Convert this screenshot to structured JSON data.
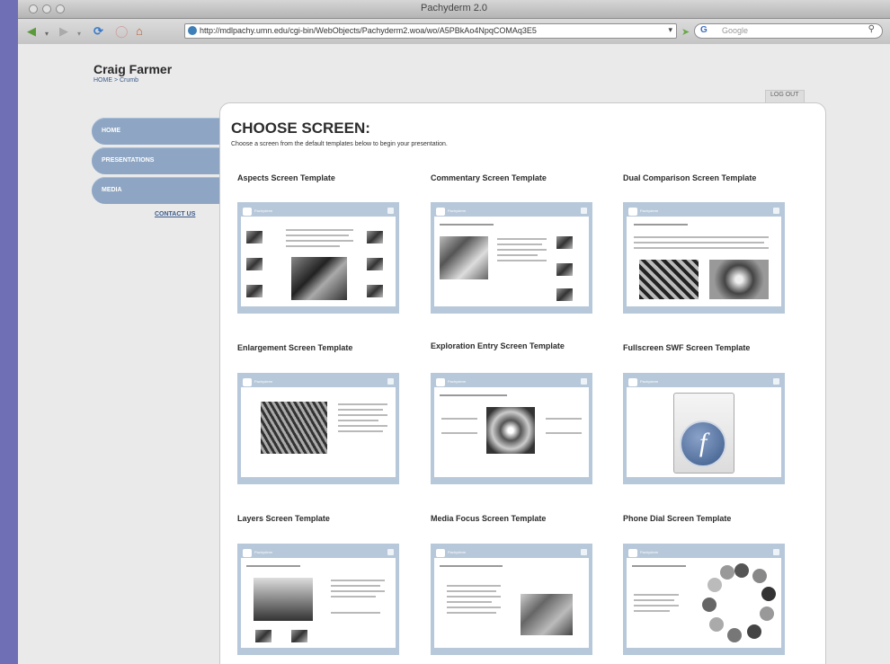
{
  "browser": {
    "window_title": "Pachyderm 2.0",
    "url": "http://mdlpachy.umn.edu/cgi-bin/WebObjects/Pachyderm2.woa/wo/A5PBkAo4NpqCOMAq3E5",
    "search_placeholder": "Google",
    "search_engine_label": "G"
  },
  "header": {
    "user_name": "Craig Farmer",
    "breadcrumb": "HOME > Crumb",
    "logout_label": "LOG OUT"
  },
  "nav": {
    "items": [
      {
        "label": "HOME"
      },
      {
        "label": "PRESENTATIONS"
      },
      {
        "label": "MEDIA"
      }
    ],
    "contact_label": "CONTACT US"
  },
  "main": {
    "heading": "CHOOSE SCREEN:",
    "subtitle": "Choose a screen from the default templates below to begin your presentation.",
    "thumb_header_label": "Pachyderm",
    "templates": [
      {
        "name": "Aspects Screen Template"
      },
      {
        "name": "Commentary Screen Template"
      },
      {
        "name": "Dual Comparison Screen Template"
      },
      {
        "name": "Enlargement Screen Template"
      },
      {
        "name": "Exploration Entry Screen Template"
      },
      {
        "name": "Fullscreen SWF Screen Template"
      },
      {
        "name": "Layers Screen Template"
      },
      {
        "name": "Media Focus Screen Template"
      },
      {
        "name": "Phone Dial Screen Template"
      }
    ]
  },
  "colors": {
    "desktop": "#6f6fb5",
    "nav_tab": "#8ea6c3",
    "thumb_frame": "#b7c8da",
    "link": "#3a5a8a"
  }
}
